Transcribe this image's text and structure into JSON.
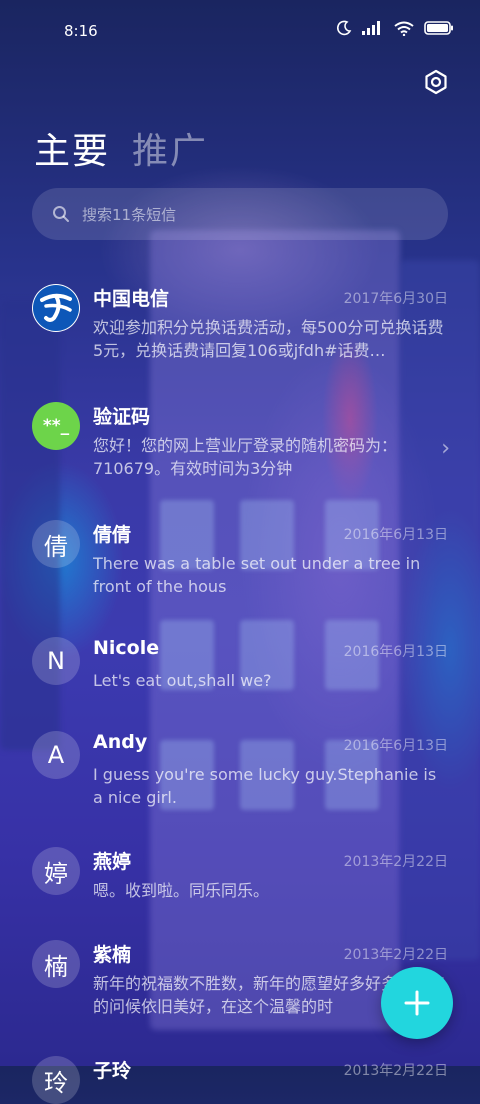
{
  "status_bar": {
    "time": "8:16"
  },
  "tabs": [
    {
      "label": "主要"
    },
    {
      "label": "推广"
    }
  ],
  "search": {
    "placeholder": "搜索11条短信"
  },
  "conversations": [
    {
      "name": "中国电信",
      "date": "2017年6月30日",
      "preview": "欢迎参加积分兑换话费活动，每500分可兑换话费5元，兑换话费请回复106或jfdh#话费…"
    },
    {
      "name": "验证码",
      "date": "",
      "avatar_text": "**_",
      "preview": "您好！您的网上营业厅登录的随机密码为：710679。有效时间为3分钟"
    },
    {
      "name": "倩倩",
      "date": "2016年6月13日",
      "avatar_text": "倩",
      "preview": "There was a table set out under a tree in front of the hous"
    },
    {
      "name": "Nicole",
      "date": "2016年6月13日",
      "avatar_text": "N",
      "preview": "Let's eat out,shall we?"
    },
    {
      "name": "Andy",
      "date": "2016年6月13日",
      "avatar_text": "A",
      "preview": "I guess you're some lucky guy.Stephanie is a nice girl."
    },
    {
      "name": "燕婷",
      "date": "2013年2月22日",
      "avatar_text": "婷",
      "preview": "嗯。收到啦。同乐同乐。"
    },
    {
      "name": "紫楠",
      "date": "2013年2月22日",
      "avatar_text": "楠",
      "preview": "新年的祝福数不胜数，新年的愿望好多好多，新年的问候依旧美好，在这个温馨的时"
    },
    {
      "name": "子玲",
      "date": "2013年2月22日",
      "avatar_text": "玲",
      "preview": ""
    }
  ],
  "colors": {
    "fab": "#22d6de",
    "verify_avatar": "#6dd44a",
    "telecom_blue": "#0d57b8"
  }
}
